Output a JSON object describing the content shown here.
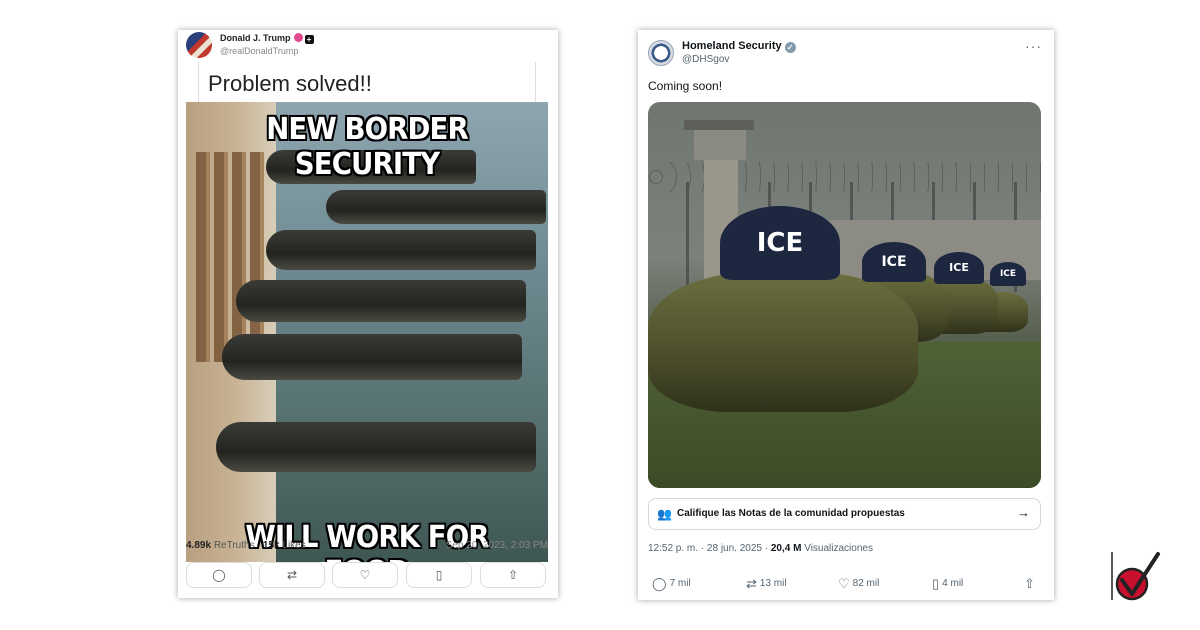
{
  "truth_post": {
    "author_name": "Donald J. Trump",
    "author_handle": "@realDonaldTrump",
    "text": "Problem solved!!",
    "meme_top_text": "NEW BORDER SECURITY",
    "meme_bottom_text": "WILL WORK FOR FOOD",
    "retruths_count": "4.89k",
    "retruths_label": "ReTruths",
    "likes_count": "15k",
    "likes_label": "Likes",
    "timestamp": "Sep 20, 2023, 2:03 PM",
    "actions": [
      {
        "icon": "reply-icon",
        "glyph": "◯"
      },
      {
        "icon": "retruth-icon",
        "glyph": "⇄"
      },
      {
        "icon": "like-icon",
        "glyph": "♡"
      },
      {
        "icon": "bookmark-icon",
        "glyph": "▯"
      },
      {
        "icon": "share-icon",
        "glyph": "⇧"
      }
    ]
  },
  "x_post": {
    "author_name": "Homeland Security",
    "author_handle": "@DHSgov",
    "more_glyph": "···",
    "text": "Coming soon!",
    "cap_text": "ICE",
    "community_notes_label": "Califique las Notas de la comunidad propuestas",
    "community_notes_arrow": "→",
    "timestamp": "12:52 p. m. · 28 jun. 2025 · ",
    "views_count": "20,4 M",
    "views_label": "Visualizaciones",
    "actions": [
      {
        "icon": "reply-icon",
        "glyph": "◯",
        "count": "7 mil"
      },
      {
        "icon": "repost-icon",
        "glyph": "⇄",
        "count": "13 mil"
      },
      {
        "icon": "like-icon",
        "glyph": "♡",
        "count": "82 mil"
      },
      {
        "icon": "bookmark-icon",
        "glyph": "▯",
        "count": "4 mil"
      },
      {
        "icon": "share-icon",
        "glyph": "⇧",
        "count": ""
      }
    ]
  },
  "colors": {
    "truth_verified": "#e14b8f",
    "x_verified": "#829aab",
    "ice_cap": "#1d2740",
    "fact_check_red": "#c8102e"
  }
}
